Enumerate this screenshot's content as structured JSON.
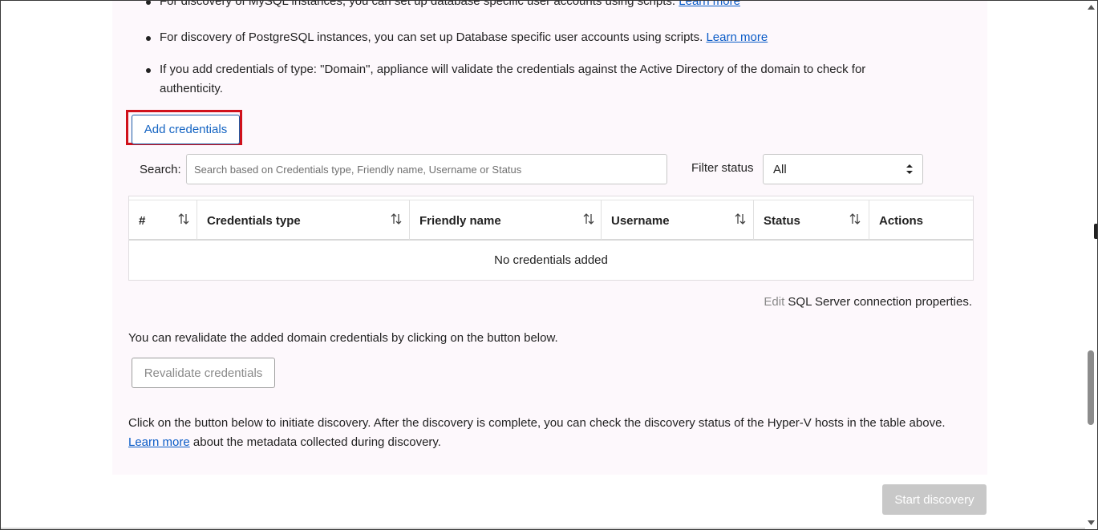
{
  "bullets": [
    {
      "text": "For discovery of MySQL instances, you can set up database specific user accounts using scripts.",
      "link": "Learn more"
    },
    {
      "text": "For discovery of PostgreSQL instances, you can set up Database specific user accounts using scripts.",
      "link": "Learn more"
    },
    {
      "text": "If you add credentials of type: \"Domain\", appliance will validate the credentials against the Active Directory of the domain to check for authenticity."
    }
  ],
  "add_credentials_label": "Add credentials",
  "search": {
    "label": "Search:",
    "placeholder": "Search based on Credentials type, Friendly name, Username or Status",
    "value": ""
  },
  "filter": {
    "label": "Filter status",
    "selected": "All"
  },
  "table": {
    "columns": [
      "#",
      "Credentials type",
      "Friendly name",
      "Username",
      "Status",
      "Actions"
    ],
    "empty_message": "No credentials added"
  },
  "edit_line": {
    "link": "Edit",
    "text": "SQL Server connection properties."
  },
  "revalidate": {
    "text": "You can revalidate the added domain credentials by clicking on the button below.",
    "button_label": "Revalidate credentials"
  },
  "discovery": {
    "text_before": "Click on the button below to initiate discovery. After the discovery is complete, you can check the discovery status of the Hyper-V hosts in the table above.",
    "link": "Learn more",
    "text_after": "about the metadata collected during discovery.",
    "start_label": "Start discovery"
  },
  "colors": {
    "link": "#0b5cc7",
    "highlight": "#d0111b",
    "panel_bg": "#fdf8fc",
    "disabled_button": "#c8c8c8"
  }
}
